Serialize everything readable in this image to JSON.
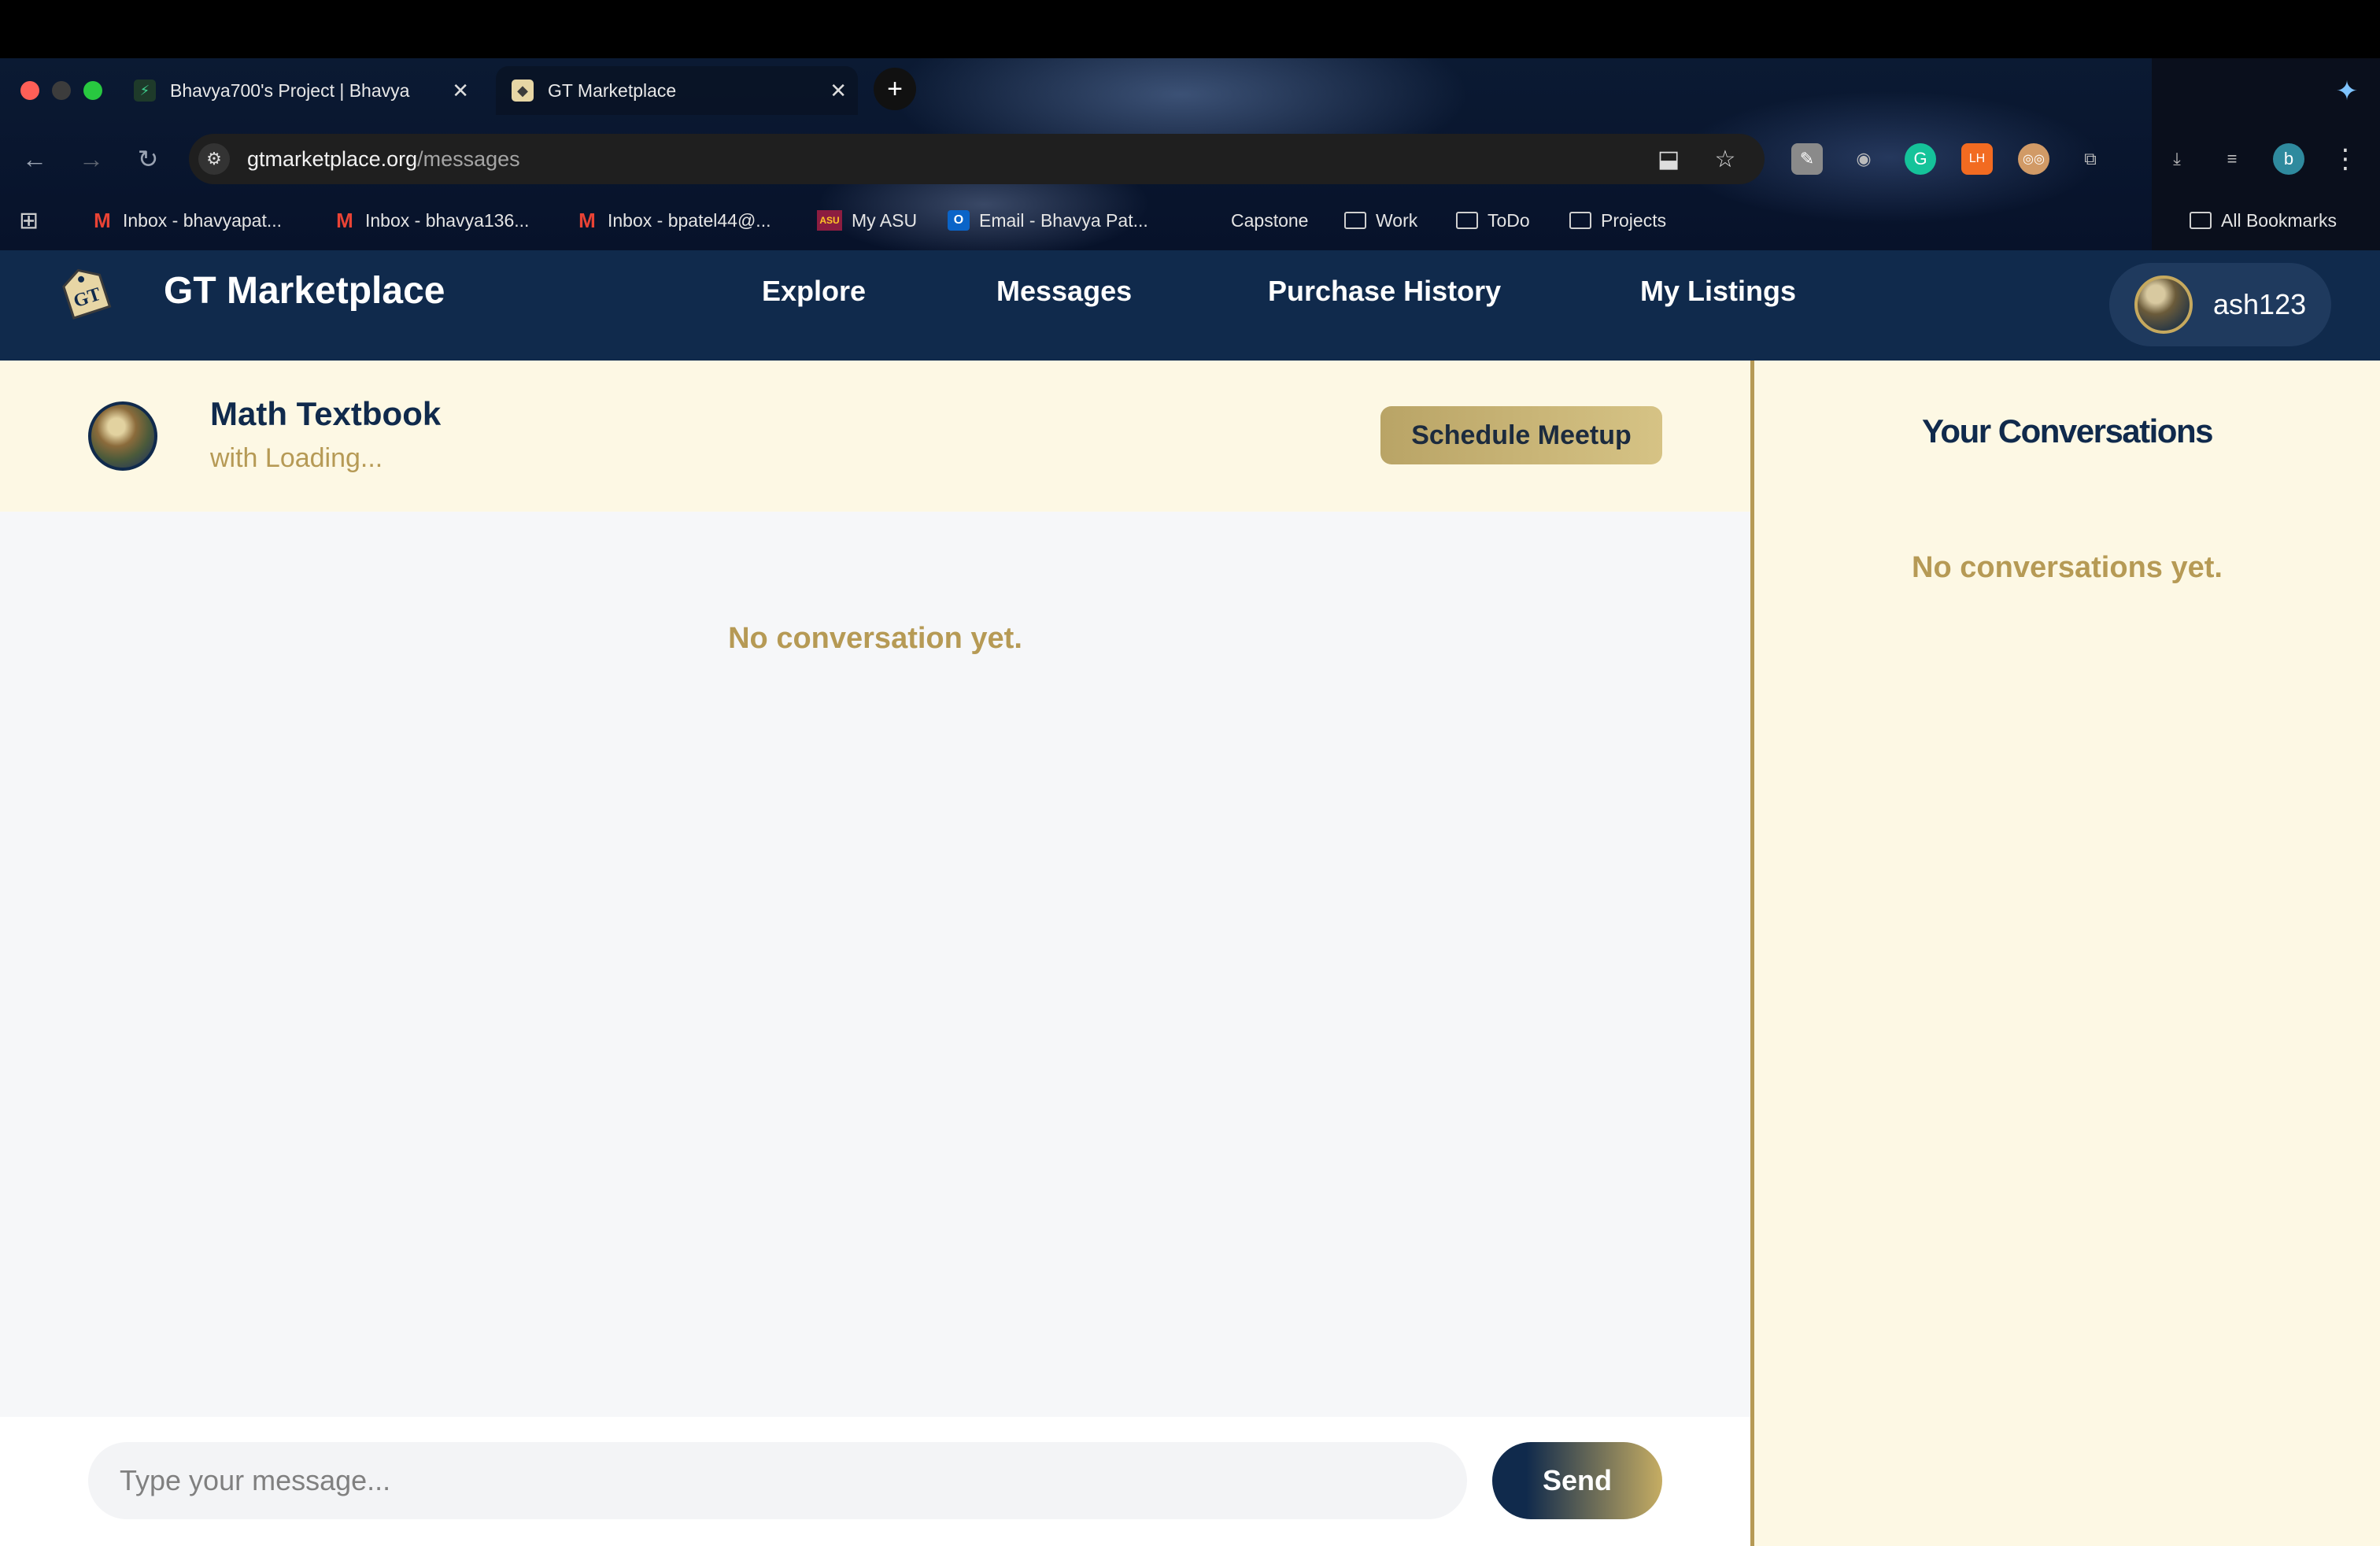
{
  "browser": {
    "tabs": [
      {
        "title": "Bhavya700's Project | Bhavya",
        "favicon": "supabase-icon"
      },
      {
        "title": "GT Marketplace",
        "favicon": "gt-tag-icon"
      }
    ],
    "url_host": "gtmarketplace.org",
    "url_path": "/messages",
    "bookmarks": [
      {
        "label": "Inbox - bhavyapat...",
        "icon": "gmail-icon"
      },
      {
        "label": "Inbox - bhavya136...",
        "icon": "gmail-icon"
      },
      {
        "label": "Inbox - bpatel44@...",
        "icon": "gmail-icon"
      },
      {
        "label": "My ASU",
        "icon": "asu-icon"
      },
      {
        "label": "Email - Bhavya Pat...",
        "icon": "outlook-icon"
      },
      {
        "label": "Capstone",
        "icon": "folder-icon"
      },
      {
        "label": "Work",
        "icon": "folder-icon"
      },
      {
        "label": "ToDo",
        "icon": "folder-icon"
      },
      {
        "label": "Projects",
        "icon": "folder-icon"
      }
    ],
    "all_bookmarks": "All Bookmarks",
    "profile_initial": "b"
  },
  "header": {
    "brand": "GT Marketplace",
    "nav": [
      "Explore",
      "Messages",
      "Purchase History",
      "My Listings"
    ],
    "username": "ash123"
  },
  "chat": {
    "listing_title": "Math Textbook",
    "subtitle": "with Loading...",
    "schedule_label": "Schedule Meetup",
    "empty_text": "No conversation yet.",
    "input_placeholder": "Type your message...",
    "send_label": "Send"
  },
  "sidebar": {
    "title": "Your Conversations",
    "empty_text": "No conversations yet."
  },
  "colors": {
    "navy": "#102a4c",
    "gold": "#b69a55",
    "cream": "#fdf8e4"
  }
}
